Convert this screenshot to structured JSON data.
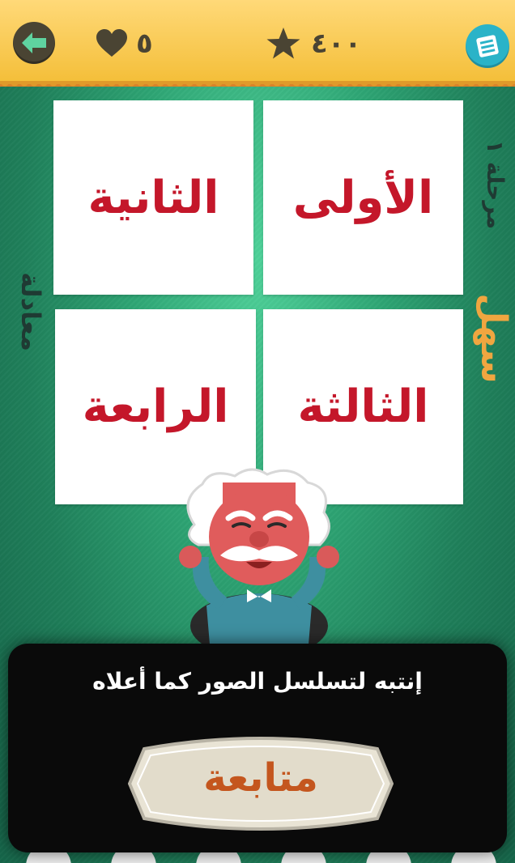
{
  "header": {
    "lives": "٥",
    "score": "٤٠٠"
  },
  "side": {
    "category": "معادلة",
    "stage": "مرحلة ١",
    "difficulty": "سهل"
  },
  "tiles": [
    {
      "label": "الأولى"
    },
    {
      "label": "الثانية"
    },
    {
      "label": "الثالثة"
    },
    {
      "label": "الرابعة"
    }
  ],
  "dialog": {
    "message": "إنتبه لتسلسل الصور كما أعلاه",
    "button_label": "متابعة"
  },
  "icons": {
    "back": "arrow-left-icon",
    "lives": "heart-icon",
    "score": "star-icon",
    "menu": "menu-icon"
  },
  "colors": {
    "topbar": "#f4bf3a",
    "tile_text": "#c4172a",
    "difficulty": "#f0a640",
    "button_text": "#c4561e"
  }
}
